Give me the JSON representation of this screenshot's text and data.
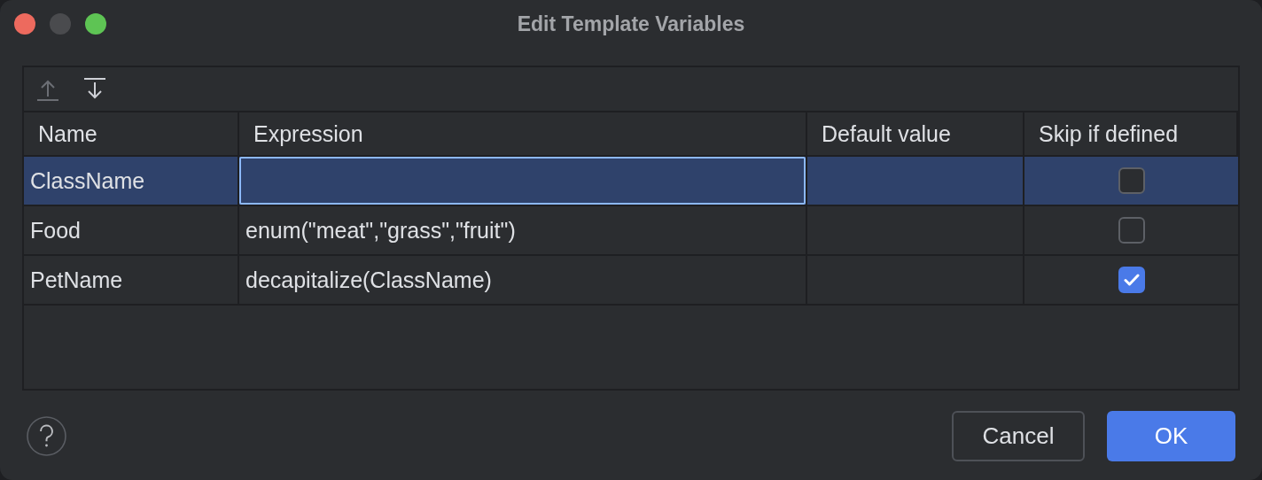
{
  "window": {
    "title": "Edit Template Variables"
  },
  "toolbar": [
    {
      "kind": "move-up",
      "disabled": true
    },
    {
      "kind": "move-down",
      "disabled": false
    }
  ],
  "table": {
    "columns": [
      "Name",
      "Expression",
      "Default value",
      "Skip if defined"
    ],
    "rows": [
      {
        "name": "ClassName",
        "expression": "",
        "default_value": "",
        "skip_if_defined": false,
        "selected": true,
        "editing": true
      },
      {
        "name": "Food",
        "expression": "enum(\"meat\",\"grass\",\"fruit\")",
        "default_value": "",
        "skip_if_defined": false,
        "selected": false,
        "editing": false
      },
      {
        "name": "PetName",
        "expression": "decapitalize(ClassName)",
        "default_value": "",
        "skip_if_defined": true,
        "selected": false,
        "editing": false
      }
    ]
  },
  "buttons": [
    {
      "label": "Cancel",
      "kind": "secondary"
    },
    {
      "label": "OK",
      "kind": "primary"
    }
  ]
}
